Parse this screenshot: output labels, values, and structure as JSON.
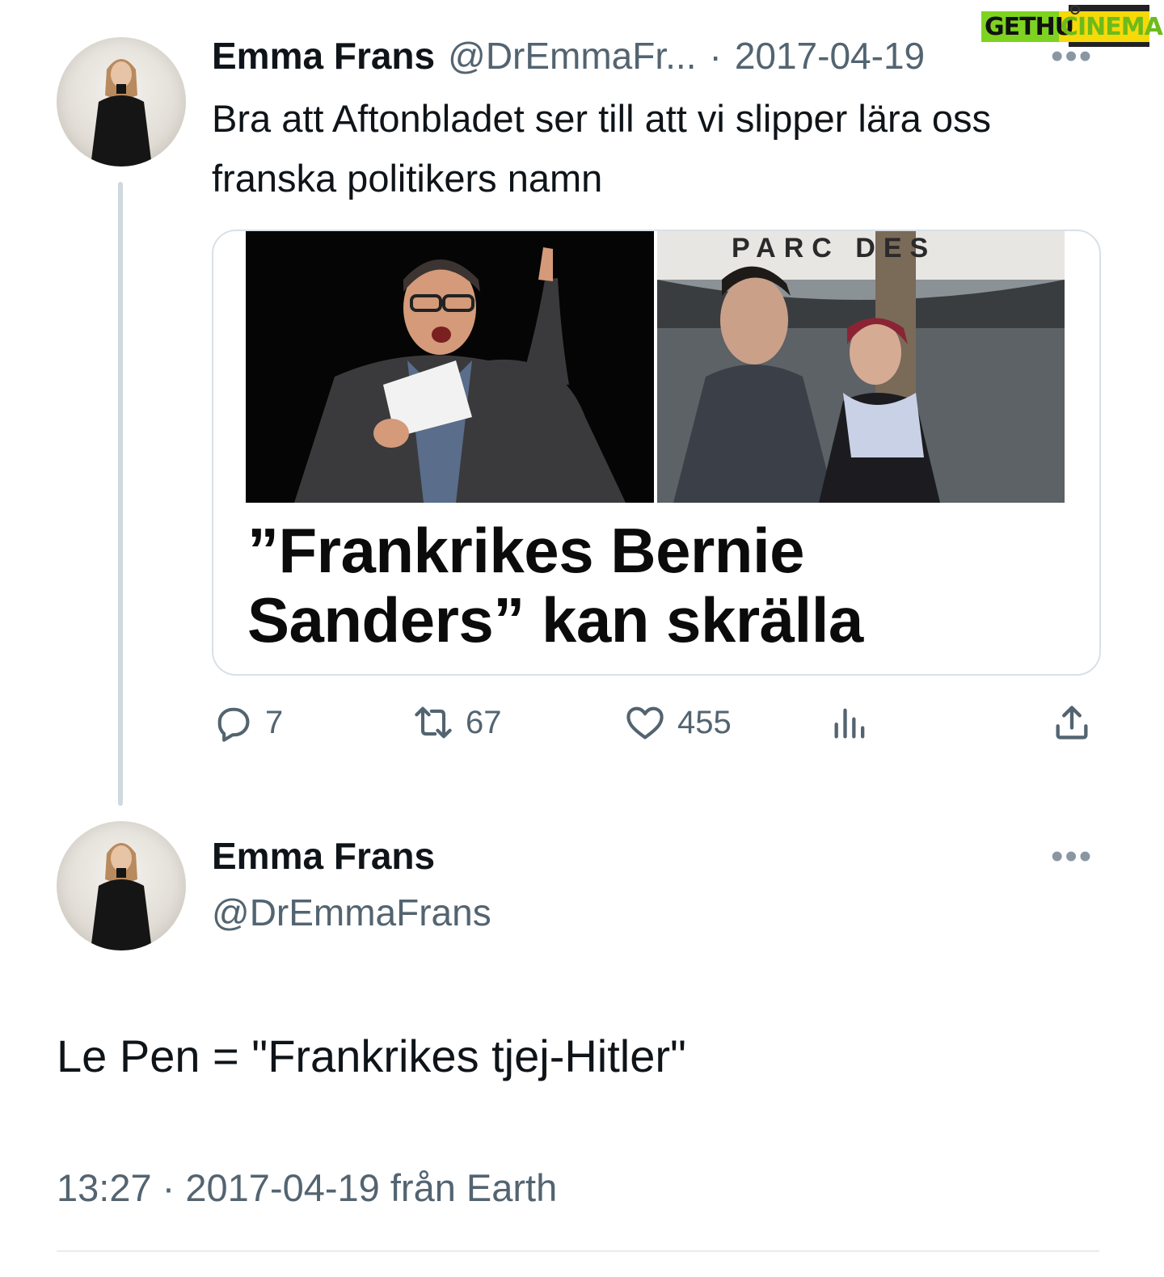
{
  "watermark": {
    "part1": "GETHU",
    "part2": "CINEMA"
  },
  "tweet1": {
    "name": "Emma Frans",
    "handle": "@DrEmmaFr...",
    "separator": "·",
    "date": "2017-04-19",
    "more": "•••",
    "text": "Bra att Aftonbladet ser till att vi slipper lära oss franska politikers namn",
    "card": {
      "sign_text": "PARC DES",
      "headline_line1": "”Frankrikes Bernie",
      "headline_line2": "Sanders” kan skrälla"
    },
    "actions": {
      "replies": "7",
      "retweets": "67",
      "likes": "455"
    }
  },
  "tweet2": {
    "name": "Emma Frans",
    "handle": "@DrEmmaFrans",
    "more": "•••",
    "text": "Le Pen = \"Frankrikes tjej-Hitler\"",
    "timestamp": "13:27 · 2017-04-19 från Earth"
  },
  "colors": {
    "text": "#0f1419",
    "secondary": "#536471",
    "thread_line": "#cfd9de",
    "watermark_green": "#7ed321",
    "watermark_yellow": "#f5d90a"
  },
  "icons": [
    "reply-icon",
    "retweet-icon",
    "like-icon",
    "views-icon",
    "share-icon",
    "more-icon"
  ]
}
